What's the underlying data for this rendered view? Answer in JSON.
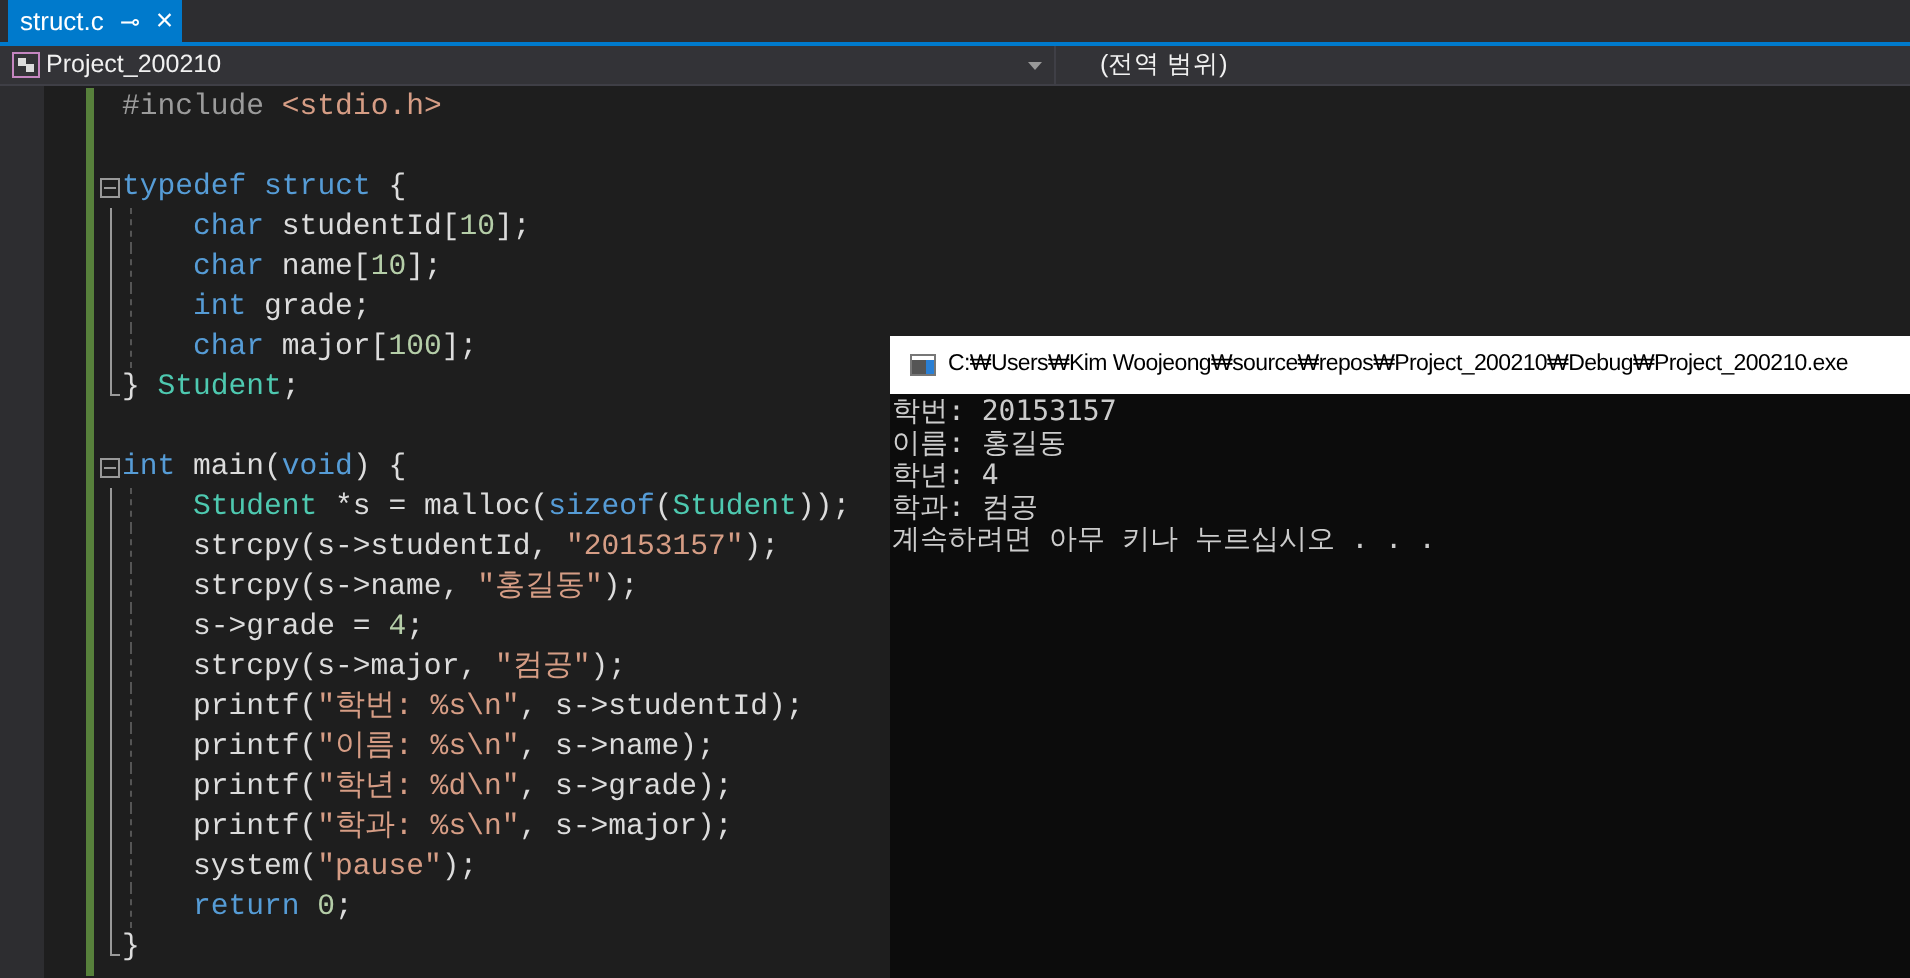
{
  "tabs": [
    {
      "label": "struct.c",
      "selected": true,
      "pin": "⊸",
      "close": "×"
    }
  ],
  "navigation": {
    "project": "Project_200210",
    "scope": "(전역 범위)"
  },
  "code_lines": [
    {
      "kind": "plain",
      "tokens": [
        {
          "kind": "pre",
          "s": "#include "
        },
        {
          "kind": "str",
          "s": "<stdio.h>"
        }
      ]
    },
    {
      "kind": "plain"
    },
    {
      "kind": "start",
      "tokens": [
        {
          "kind": "kw",
          "s": "typedef"
        },
        {
          "kind": "kw",
          "s": " struct"
        },
        {
          "kind": "p",
          "s": " {"
        }
      ]
    },
    {
      "kind": "body",
      "tokens": [
        {
          "kind": "kw",
          "s": "char"
        },
        {
          "kind": "p",
          "s": " studentId["
        },
        {
          "kind": "num",
          "s": "10"
        },
        {
          "kind": "p",
          "s": "];"
        }
      ]
    },
    {
      "kind": "body",
      "tokens": [
        {
          "kind": "kw",
          "s": "char"
        },
        {
          "kind": "p",
          "s": " name["
        },
        {
          "kind": "num",
          "s": "10"
        },
        {
          "kind": "p",
          "s": "];"
        }
      ]
    },
    {
      "kind": "body",
      "tokens": [
        {
          "kind": "kw",
          "s": "int"
        },
        {
          "kind": "p",
          "s": " grade;"
        }
      ]
    },
    {
      "kind": "body",
      "tokens": [
        {
          "kind": "kw",
          "s": "char"
        },
        {
          "kind": "p",
          "s": " major["
        },
        {
          "kind": "num",
          "s": "100"
        },
        {
          "kind": "p",
          "s": "];"
        }
      ]
    },
    {
      "kind": "end",
      "tokens": [
        {
          "kind": "p",
          "s": "} "
        },
        {
          "kind": "type",
          "s": "Student"
        },
        {
          "kind": "p",
          "s": ";"
        }
      ]
    },
    {
      "kind": "plain"
    },
    {
      "kind": "start",
      "tokens": [
        {
          "kind": "kw",
          "s": "int"
        },
        {
          "kind": "p",
          "s": " main("
        },
        {
          "kind": "kw",
          "s": "void"
        },
        {
          "kind": "p",
          "s": ") {"
        }
      ]
    },
    {
      "kind": "body",
      "tokens": [
        {
          "kind": "type",
          "s": "Student"
        },
        {
          "kind": "p",
          "s": " *s = malloc("
        },
        {
          "kind": "kw",
          "s": "sizeof"
        },
        {
          "kind": "p",
          "s": "("
        },
        {
          "kind": "type",
          "s": "Student"
        },
        {
          "kind": "p",
          "s": "));"
        }
      ]
    },
    {
      "kind": "body",
      "tokens": [
        {
          "kind": "p",
          "s": "strcpy(s->studentId, "
        },
        {
          "kind": "str",
          "s": "\"20153157\""
        },
        {
          "kind": "p",
          "s": ");"
        }
      ]
    },
    {
      "kind": "body",
      "tokens": [
        {
          "kind": "p",
          "s": "strcpy(s->name, "
        },
        {
          "kind": "str",
          "s": "\"홍길동\""
        },
        {
          "kind": "p",
          "s": ");"
        }
      ]
    },
    {
      "kind": "body",
      "tokens": [
        {
          "kind": "p",
          "s": "s->grade = "
        },
        {
          "kind": "num",
          "s": "4"
        },
        {
          "kind": "p",
          "s": ";"
        }
      ]
    },
    {
      "kind": "body",
      "tokens": [
        {
          "kind": "p",
          "s": "strcpy(s->major, "
        },
        {
          "kind": "str",
          "s": "\"컴공\""
        },
        {
          "kind": "p",
          "s": ");"
        }
      ]
    },
    {
      "kind": "body",
      "tokens": [
        {
          "kind": "p",
          "s": "printf("
        },
        {
          "kind": "str",
          "s": "\"학번: %s\\n\""
        },
        {
          "kind": "p",
          "s": ", s->studentId);"
        }
      ]
    },
    {
      "kind": "body",
      "tokens": [
        {
          "kind": "p",
          "s": "printf("
        },
        {
          "kind": "str",
          "s": "\"이름: %s\\n\""
        },
        {
          "kind": "p",
          "s": ", s->name);"
        }
      ]
    },
    {
      "kind": "body",
      "tokens": [
        {
          "kind": "p",
          "s": "printf("
        },
        {
          "kind": "str",
          "s": "\"학년: %d\\n\""
        },
        {
          "kind": "p",
          "s": ", s->grade);"
        }
      ]
    },
    {
      "kind": "body",
      "tokens": [
        {
          "kind": "p",
          "s": "printf("
        },
        {
          "kind": "str",
          "s": "\"학과: %s\\n\""
        },
        {
          "kind": "p",
          "s": ", s->major);"
        }
      ]
    },
    {
      "kind": "body",
      "tokens": [
        {
          "kind": "p",
          "s": "system("
        },
        {
          "kind": "str",
          "s": "\"pause\""
        },
        {
          "kind": "p",
          "s": ");"
        }
      ]
    },
    {
      "kind": "body",
      "tokens": [
        {
          "kind": "kw",
          "s": "return"
        },
        {
          "kind": "num",
          "s": " 0"
        },
        {
          "kind": "p",
          "s": ";"
        }
      ]
    },
    {
      "kind": "end",
      "tokens": [
        {
          "kind": "p",
          "s": "}"
        }
      ]
    }
  ],
  "console": {
    "title": "C:₩Users₩Kim Woojeong₩source₩repos₩Project_200210₩Debug₩Project_200210.exe",
    "lines": [
      "학번: 20153157",
      "이름: 홍길동",
      "학년: 4",
      "학과: 컴공",
      "계속하려면 아무 키나 누르십시오 . . ."
    ]
  }
}
